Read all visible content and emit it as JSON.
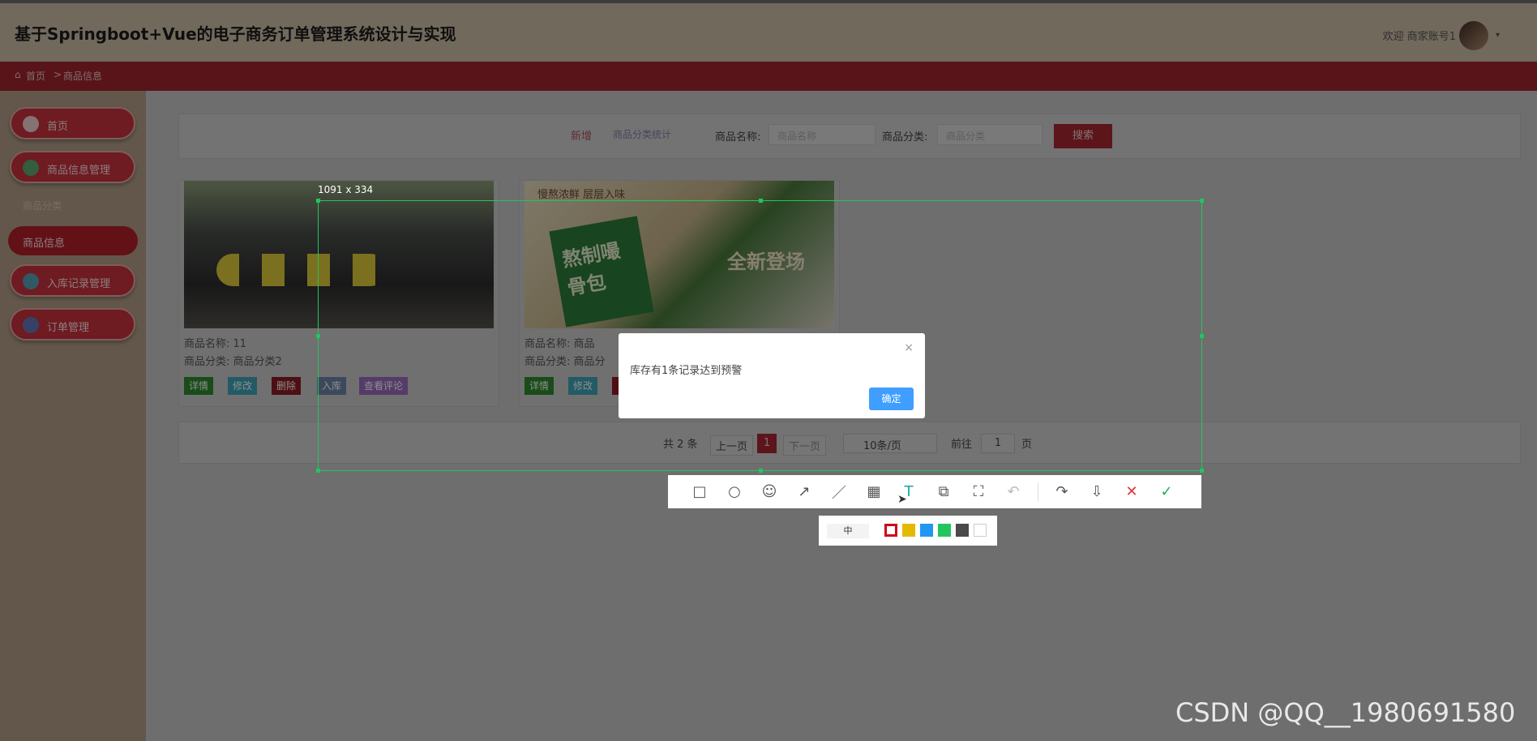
{
  "header": {
    "title": "基于Springboot+Vue的电子商务订单管理系统设计与实现",
    "welcome": "欢迎 商家账号1"
  },
  "breadcrumb": {
    "home": "首页",
    "sep": ">",
    "current": "商品信息"
  },
  "sidebar": {
    "items": [
      {
        "label": "首页"
      },
      {
        "label": "商品信息管理"
      },
      {
        "label": "入库记录管理"
      },
      {
        "label": "订单管理"
      }
    ],
    "sub_label": "商品分类",
    "active_label": "商品信息"
  },
  "search": {
    "add_label": "新增",
    "design_label": "商品分类统计",
    "name_label": "商品名称:",
    "name_placeholder": "商品名称",
    "category_label": "商品分类:",
    "category_placeholder": "商品分类",
    "search_button": "搜索"
  },
  "cards": [
    {
      "name": "商品名称:  11",
      "category": "商品分类:  商品分类2",
      "buttons": [
        "详情",
        "修改",
        "删除",
        "入库",
        "查看评论"
      ]
    },
    {
      "name": "商品名称:  商品",
      "category": "商品分类:  商品分",
      "buttons": [
        "详情",
        "修改"
      ],
      "image_caption": "慢熬浓鲜 层层入味",
      "product_text": "熬制嘬骨包",
      "badge": "全新登场"
    }
  ],
  "pager": {
    "total": "共 2 条",
    "prev": "上一页",
    "page": "1",
    "next": "下一页",
    "size": "10条/页",
    "goto": "前往",
    "goto_value": "1",
    "page_unit": "页"
  },
  "screenshot": {
    "size_label": "1091 x 334"
  },
  "dialog": {
    "message": "库存有1条记录达到预警",
    "close": "×",
    "ok": "确定"
  },
  "palette": {
    "size": "中",
    "colors": [
      "#ffffff",
      "#e6b800",
      "#2196f3",
      "#22c55e",
      "#4a4a4a",
      "#ffffff"
    ]
  },
  "watermark": "CSDN @QQ__1980691580"
}
